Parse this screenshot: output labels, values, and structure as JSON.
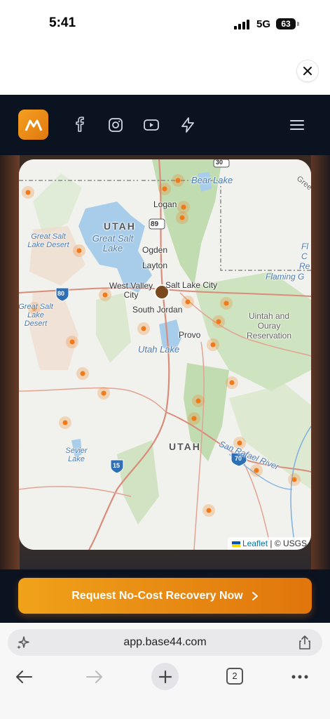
{
  "status_bar": {
    "time": "5:41",
    "network": "5G",
    "battery": "63"
  },
  "header": {
    "icons": [
      "logo-icon",
      "facebook-icon",
      "instagram-icon",
      "youtube-icon",
      "bolt-icon",
      "menu-icon"
    ]
  },
  "map": {
    "labels": {
      "bear_lake": "Bear Lake",
      "logan": "Logan",
      "utah_north": "UTAH",
      "great_salt_lake": "Great Salt Lake",
      "great_salt_lake_desert_1": "Great Salt Lake Desert",
      "great_salt_lake_desert_2": "Great Salt Lake Desert",
      "ogden": "Ogden",
      "layton": "Layton",
      "west_valley_city": "West Valley City",
      "salt_lake_city": "Salt Lake City",
      "south_jordan": "South Jordan",
      "provo": "Provo",
      "utah_lake": "Utah Lake",
      "uintah": "Uintah and Ouray Reservation",
      "flaming": "Flaming G",
      "gree": "Gree",
      "fl": "Fl",
      "c": "C",
      "re": "Re",
      "sevier_lake": "Sevier Lake",
      "utah_south": "UTAH",
      "san_rafael_river": "San Rafael River",
      "i80": "80",
      "i89": "89",
      "i30": "30",
      "i15": "15",
      "i70": "70"
    },
    "attribution_leaflet": "Leaflet",
    "attribution_rest": " | © USGS"
  },
  "cta": {
    "label": "Request No-Cost Recovery Now"
  },
  "browser": {
    "url": "app.base44.com",
    "tab_count": "2"
  },
  "colors": {
    "brand_orange": "#f0a21a",
    "navbar": "#0b1220",
    "marker": "#f07a1a"
  }
}
